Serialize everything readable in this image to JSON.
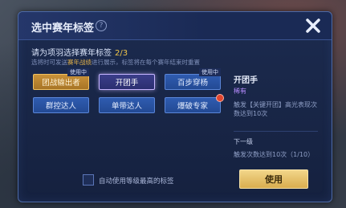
{
  "dialog": {
    "title": "选中赛年标签",
    "help_icon": "?",
    "instruction": "请为项羽选择赛年标签",
    "selected_count": "2/3",
    "note_prefix": "选将时可发送",
    "note_highlight": "赛年战绩",
    "note_suffix": "进行展示，标签将在每个赛年结束时重置"
  },
  "tags": [
    {
      "label": "团战输出者",
      "style": "gold",
      "badge": "使用中"
    },
    {
      "label": "开团手",
      "style": "selected",
      "badge": ""
    },
    {
      "label": "百步穿杨",
      "style": "normal",
      "badge": "使用中"
    },
    {
      "label": "群控达人",
      "style": "normal",
      "badge": ""
    },
    {
      "label": "单带达人",
      "style": "normal",
      "badge": ""
    },
    {
      "label": "爆破专家",
      "style": "normal",
      "badge": "",
      "new": true
    }
  ],
  "detail": {
    "name": "开团手",
    "rarity": "稀有",
    "description": "触发【关键开团】高光表现次数达到10次",
    "next_title": "下一级",
    "next_description": "触发次数达到10次（1/10）"
  },
  "footer": {
    "auto_use_label": "自动使用等级最高的标签",
    "use_button": "使用"
  },
  "colors": {
    "panel_bg": "#1c2b4f",
    "accent_gold": "#f0c64a",
    "rarity_purple": "#b78cff"
  }
}
